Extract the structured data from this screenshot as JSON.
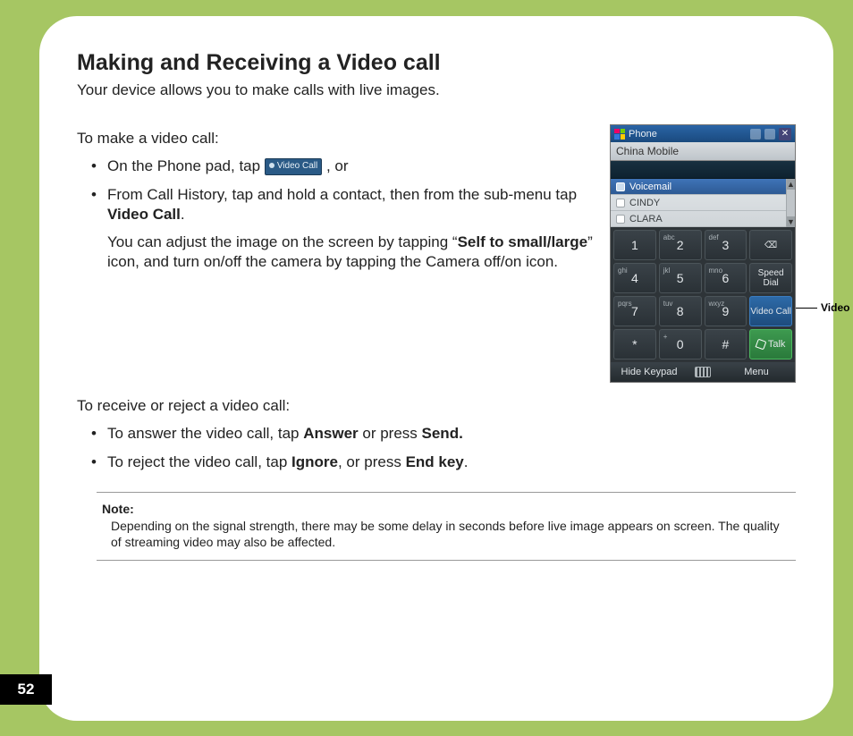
{
  "page_number": "52",
  "title": "Making and Receiving a Video call",
  "intro": "Your device allows you to make calls with live images.",
  "make": {
    "lead": "To make a video call:",
    "item1_pre": "On the Phone pad, tap ",
    "item1_btn": "Video Call",
    "item1_post": " , or",
    "item2_a": "From Call History, tap and hold a contact, then from the sub-menu tap ",
    "item2_b": "Video Call",
    "item2_c": ".",
    "item2_d": "You can adjust the image on the screen by tapping “",
    "item2_e": "Self to small/large",
    "item2_f": "” icon, and turn on/off the camera by tapping the Camera off/on icon."
  },
  "receive": {
    "lead": "To receive or reject a video call:",
    "a1_pre": "To answer the video call, tap ",
    "a1_b1": "Answer",
    "a1_mid": " or press ",
    "a1_b2": "Send.",
    "a2_pre": "To reject the video call, tap ",
    "a2_b1": "Ignore",
    "a2_mid": ", or press ",
    "a2_b2": "End key",
    "a2_post": "."
  },
  "note": {
    "label": "Note:",
    "body": "Depending on the signal strength, there may be some delay in seconds before live image appears on screen. The quality of streaming video may also be affected."
  },
  "callout": "Video call button",
  "phone": {
    "status_title": "Phone",
    "carrier": "China Mobile",
    "contacts": [
      "Voicemail",
      "CINDY",
      "CLARA"
    ],
    "keys": {
      "r1": [
        "1",
        "2",
        "3"
      ],
      "r1sub": [
        "",
        "abc",
        "def"
      ],
      "r2": [
        "4",
        "5",
        "6"
      ],
      "r2sub": [
        "ghi",
        "jkl",
        "mno"
      ],
      "speed": "Speed Dial",
      "r3": [
        "7",
        "8",
        "9"
      ],
      "r3sub": [
        "pqrs",
        "tuv",
        "wxyz"
      ],
      "video": "Video Call",
      "r4": [
        "*",
        "0",
        "#"
      ],
      "r4sub": [
        "",
        "+",
        ""
      ],
      "talk": "Talk"
    },
    "soft_left": "Hide Keypad",
    "soft_right": "Menu"
  }
}
